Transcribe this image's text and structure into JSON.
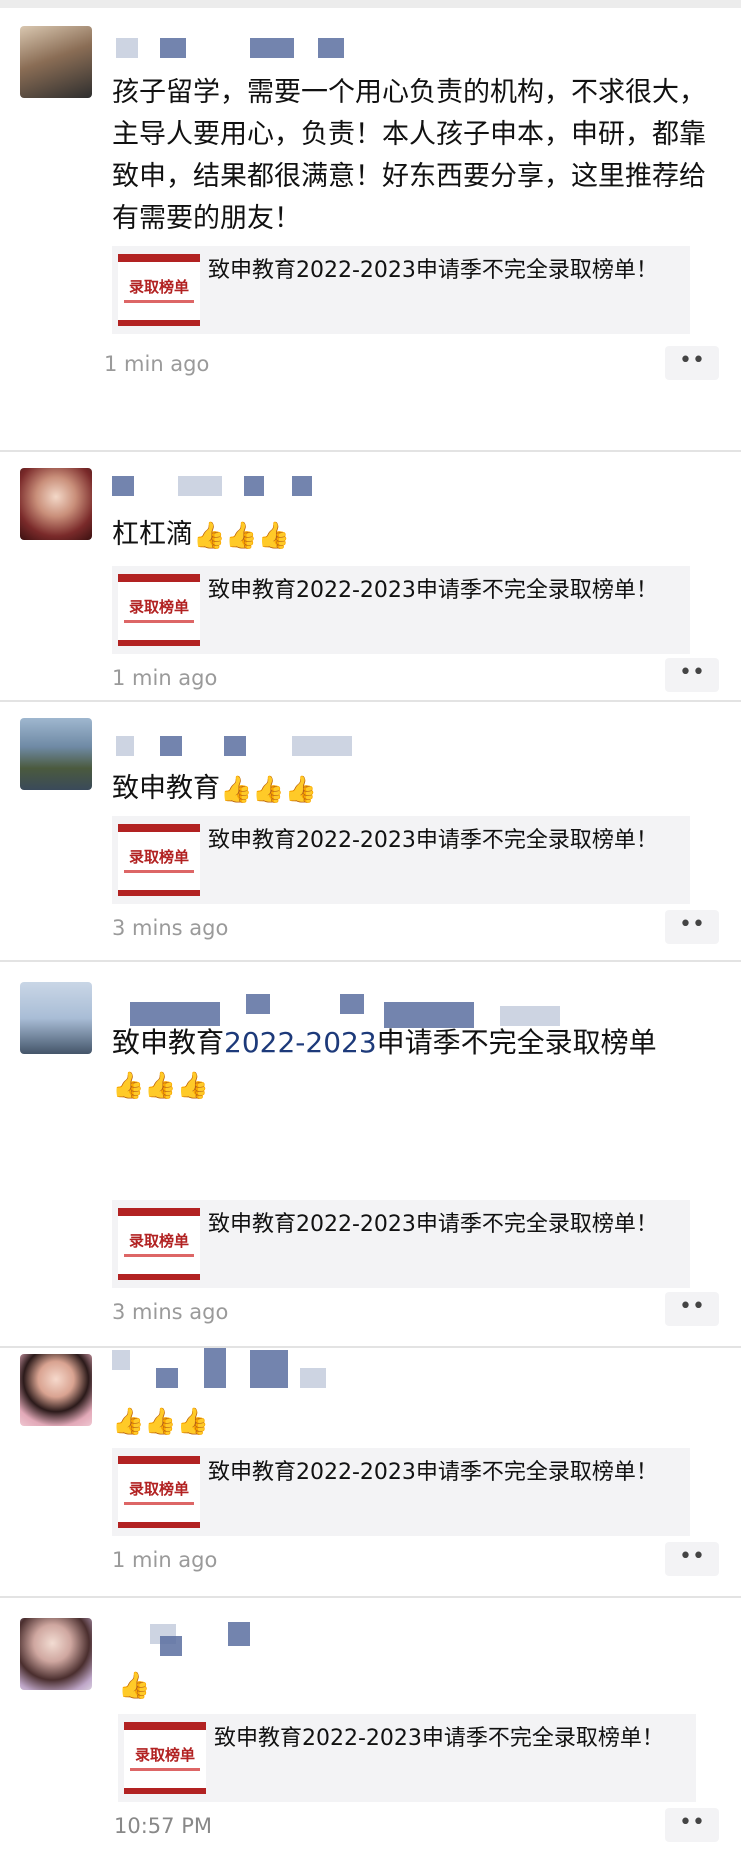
{
  "posts": [
    {
      "text": "孩子留学，需要一个用心负责的机构，不求很大，主导人要用心，负责！本人孩子申本，申研，都靠致申，结果都很满意！好东西要分享，这里推荐给有需要的朋友！",
      "card": {
        "thumb_title": "录取榜单",
        "text": "致申教育2022-2023申请季不完全录取榜单！"
      },
      "time": "1 min ago",
      "more": "••"
    },
    {
      "text": "杠杠滴",
      "emojis": "👍👍👍",
      "card": {
        "thumb_title": "录取榜单",
        "text": "致申教育2022-2023申请季不完全录取榜单！"
      },
      "time": "1 min ago",
      "more": "••"
    },
    {
      "text": "致申教育",
      "emojis": "👍👍👍",
      "card": {
        "thumb_title": "录取榜单",
        "text": "致申教育2022-2023申请季不完全录取榜单！"
      },
      "time": "3 mins ago",
      "more": "••"
    },
    {
      "text_pre": "致申教育",
      "text_accent": "2022-2023",
      "text_post": "申请季不完全录取榜单",
      "emojis": "👍👍👍",
      "card": {
        "thumb_title": "录取榜单",
        "text": "致申教育2022-2023申请季不完全录取榜单！"
      },
      "time": "3 mins ago",
      "more": "••"
    },
    {
      "emojis": "👍👍👍",
      "card": {
        "thumb_title": "录取榜单",
        "text": "致申教育2022-2023申请季不完全录取榜单！"
      },
      "time": "1 min ago",
      "more": "••"
    },
    {
      "emojis": "👍",
      "card": {
        "thumb_title": "录取榜单",
        "text": "致申教育2022-2023申请季不完全录取榜单！"
      },
      "time": "10:57 PM",
      "more": "••"
    }
  ],
  "colors": {
    "accent_text": "#1d3a7a",
    "thumb_red": "#b22222",
    "card_bg": "#f3f3f5",
    "timestamp": "#9a9a9a"
  },
  "icons": {
    "avatar": "user-avatar-photo",
    "like": "thumbs-up-emoji",
    "more": "more-dots-icon"
  }
}
